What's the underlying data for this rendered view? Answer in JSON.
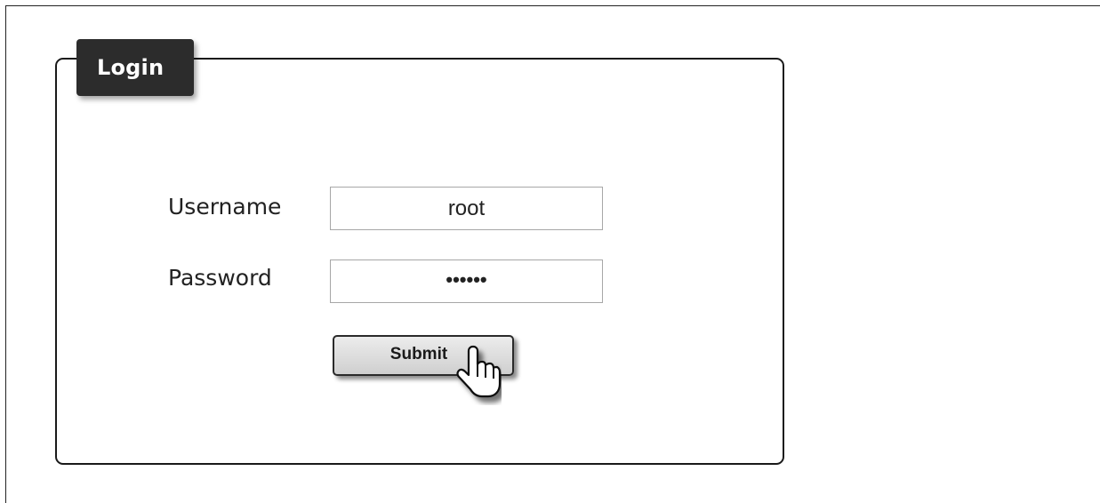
{
  "login": {
    "title": "Login",
    "username_label": "Username",
    "username_value": "root",
    "password_label": "Password",
    "password_value": "••••••",
    "submit_label": "Submit"
  },
  "colors": {
    "tab_background": "#2c2c2c",
    "panel_border": "#1a1a1a",
    "button_background": "#dcdcdc"
  },
  "icons": {
    "cursor": "hand-pointer-icon"
  }
}
